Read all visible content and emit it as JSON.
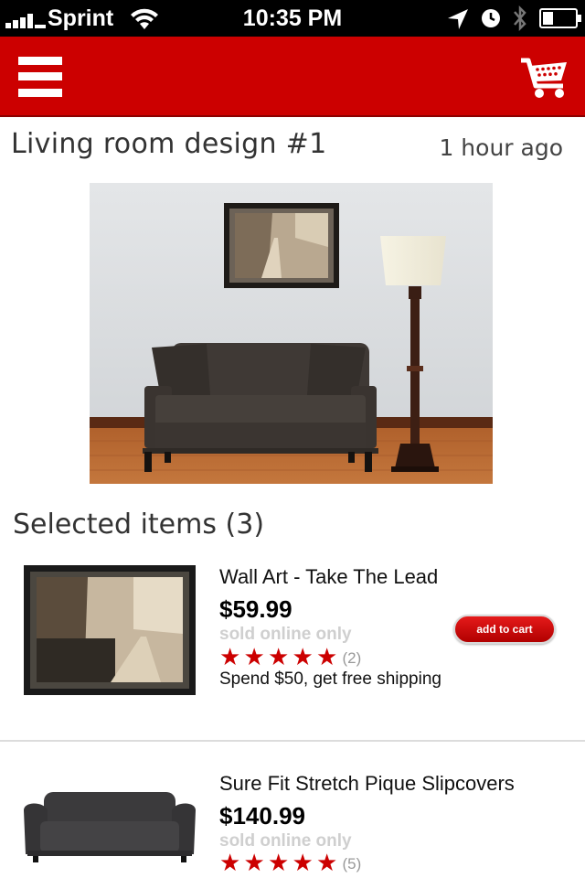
{
  "status_bar": {
    "carrier": "Sprint",
    "time": "10:35 PM"
  },
  "header": {
    "menu_icon": "hamburger-icon",
    "cart_icon": "shopping-cart-icon",
    "brand_color": "#cc0000"
  },
  "board": {
    "title": "Living room design #1",
    "timestamp": "1 hour ago"
  },
  "selected": {
    "heading": "Selected items (3)",
    "items": [
      {
        "name": "Wall Art - Take The Lead",
        "price": "$59.99",
        "availability": "sold online only",
        "rating": 5,
        "reviews": "(2)",
        "promo": "Spend $50, get free shipping",
        "button": "add to cart"
      },
      {
        "name": "Sure Fit Stretch Pique Slipcovers",
        "price": "$140.99",
        "availability": "sold online only",
        "rating": 5,
        "reviews": "(5)"
      }
    ]
  }
}
